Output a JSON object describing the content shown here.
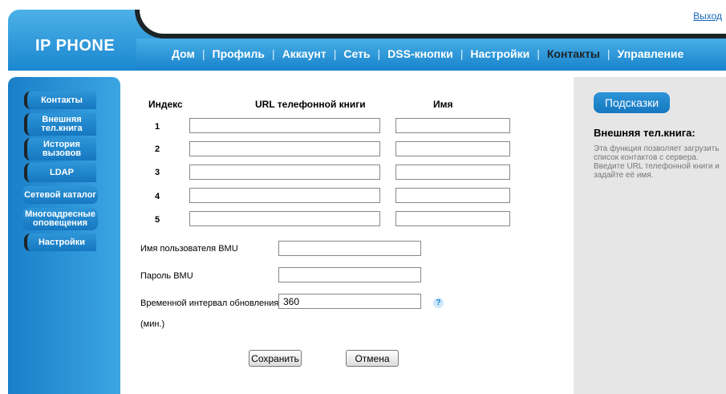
{
  "header": {
    "logo": "IP PHONE",
    "logout": "Выход"
  },
  "nav": {
    "items": [
      "Дом",
      "Профиль",
      "Аккаунт",
      "Сеть",
      "DSS-кнопки",
      "Настройки",
      "Контакты",
      "Управление"
    ],
    "active": "Контакты"
  },
  "sidebar": {
    "items": [
      "Контакты",
      "Внешняя тел.книга",
      "История вызовов",
      "LDAP",
      "Сетевой каталог",
      "Многоадресные оповещения",
      "Настройки"
    ]
  },
  "table": {
    "headers": {
      "index": "Индекс",
      "url": "URL телефонной книги",
      "name": "Имя"
    },
    "rows": [
      {
        "index": "1",
        "url": "",
        "name": ""
      },
      {
        "index": "2",
        "url": "",
        "name": ""
      },
      {
        "index": "3",
        "url": "",
        "name": ""
      },
      {
        "index": "4",
        "url": "",
        "name": ""
      },
      {
        "index": "5",
        "url": "",
        "name": ""
      }
    ]
  },
  "fields": {
    "bmu_user_label": "Имя пользователя BMU",
    "bmu_user_value": "",
    "bmu_password_label": "Пароль BMU",
    "bmu_password_value": "",
    "interval_label": "Временной интервал обновления",
    "interval_unit": "(мин.)",
    "interval_value": "360",
    "help_glyph": "?"
  },
  "buttons": {
    "save": "Сохранить",
    "cancel": "Отмена"
  },
  "hints": {
    "tab": "Подсказки",
    "title": "Внешняя тел.книга:",
    "text": "Эта функция позволяет загрузить список контактов с сервера. Введите URL телефонной книги и задайте её имя."
  },
  "colors": {
    "accent": "#1a87cf",
    "dark": "#1d2428",
    "help_panel": "#e6e6e6",
    "link": "#1565b8"
  }
}
